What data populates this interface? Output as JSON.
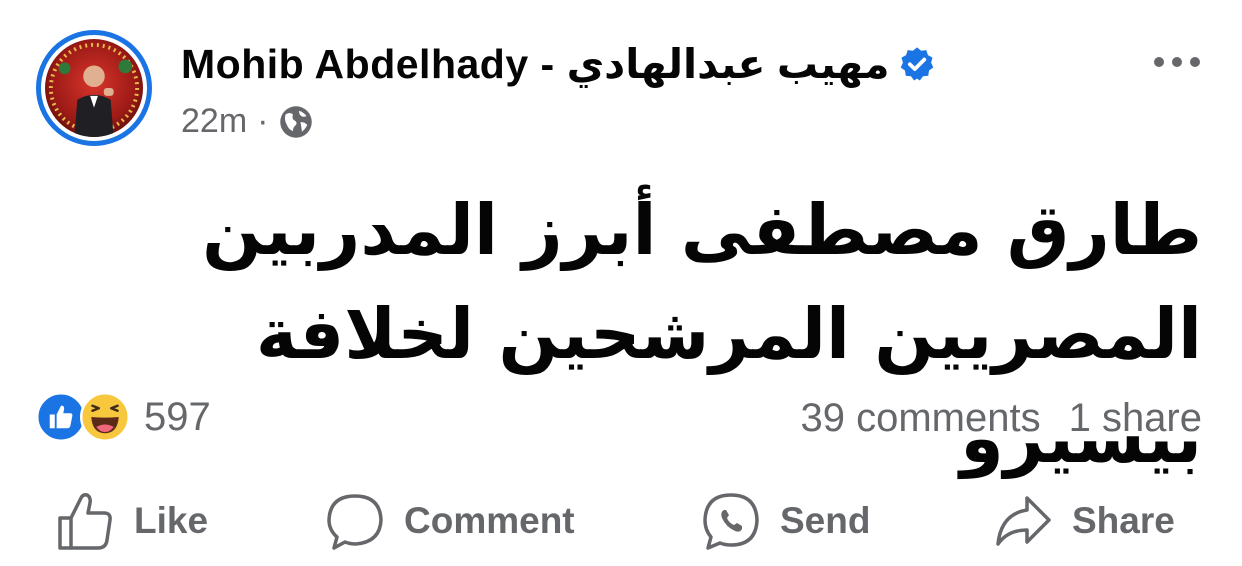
{
  "post": {
    "author": {
      "name": "Mohib Abdelhady - مهيب عبدالهادي",
      "verified": true
    },
    "time": "22m",
    "separator": "·",
    "audience_icon": "globe-icon",
    "text": "طارق مصطفى أبرز المدربين المصريين المرشحين لخلافة بيسيرو"
  },
  "reactions": {
    "types": [
      "like",
      "haha"
    ],
    "count": "597"
  },
  "engagement": {
    "comments": "39 comments",
    "shares": "1 share"
  },
  "actions": {
    "like": "Like",
    "comment": "Comment",
    "send": "Send",
    "share": "Share"
  },
  "colors": {
    "accent": "#1b74e4",
    "text": "#050505",
    "secondary": "#65676b",
    "haha": "#f7c83e"
  }
}
